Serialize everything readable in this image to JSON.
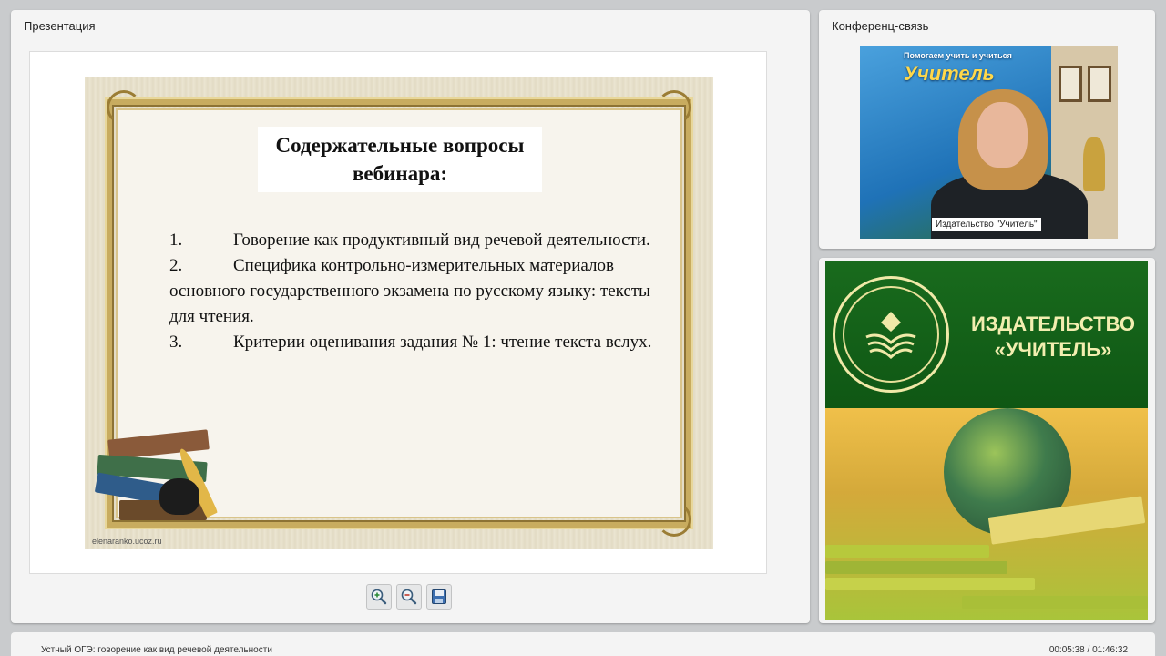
{
  "presentation": {
    "title": "Презентация",
    "slide": {
      "heading": "Содержательные вопросы вебинара:",
      "items": [
        {
          "number": "1.",
          "text": "Говорение как продуктивный вид речевой деятельности."
        },
        {
          "number": "2.",
          "text": "Специфика контрольно-измерительных материалов основного государственного экзамена по русскому языку: тексты для чтения."
        },
        {
          "number": "3.",
          "text": "Критерии оценивания задания № 1: чтение текста вслух."
        }
      ],
      "watermark": "elenaranko.ucoz.ru"
    },
    "toolbar": {
      "zoom_in_icon": "zoom-in-icon",
      "zoom_out_icon": "zoom-out-icon",
      "save_icon": "save-icon"
    }
  },
  "conference": {
    "title": "Конференц-связь",
    "video": {
      "banner_line1": "Помогаем учить и учиться",
      "banner_line2": "Учитель",
      "speaker_label": "Издательство \"Учитель\""
    }
  },
  "publisher": {
    "name": "ИЗДАТЕЛЬСТВО «УЧИТЕЛЬ»",
    "colors": {
      "green": "#196b1d",
      "text": "#f3eeb0"
    }
  },
  "footer": {
    "title": "Устный ОГЭ: говорение как вид речевой деятельности",
    "time": "00:05:38 / 01:46:32"
  }
}
